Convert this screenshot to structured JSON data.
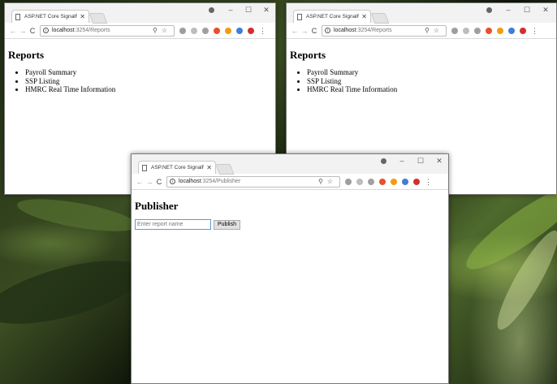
{
  "windows": [
    {
      "tab_title": "ASP.NET Core SignalR",
      "url_host": "localhost",
      "url_rest": ":3254/Reports",
      "heading": "Reports",
      "items": [
        "Payroll Summary",
        "SSP Listing",
        "HMRC Real Time Information"
      ]
    },
    {
      "tab_title": "ASP.NET Core SignalR",
      "url_host": "localhost",
      "url_rest": ":3254/Reports",
      "heading": "Reports",
      "items": [
        "Payroll Summary",
        "SSP Listing",
        "HMRC Real Time Information"
      ]
    },
    {
      "tab_title": "ASP.NET Core SignalR",
      "url_host": "localhost",
      "url_rest": ":3254/Publisher",
      "heading": "Publisher",
      "input_placeholder": "Enter report name",
      "button_label": "Publish"
    }
  ],
  "icons": {
    "back": "←",
    "forward": "→",
    "reload": "C",
    "close": "✕",
    "minimize": "–",
    "maximize": "☐"
  },
  "extension_colors": [
    "#9e9e9e",
    "#bdbdbd",
    "#a0a0a0",
    "#e8502a",
    "#f39c12",
    "#3f7fd6",
    "#d32f2f"
  ]
}
